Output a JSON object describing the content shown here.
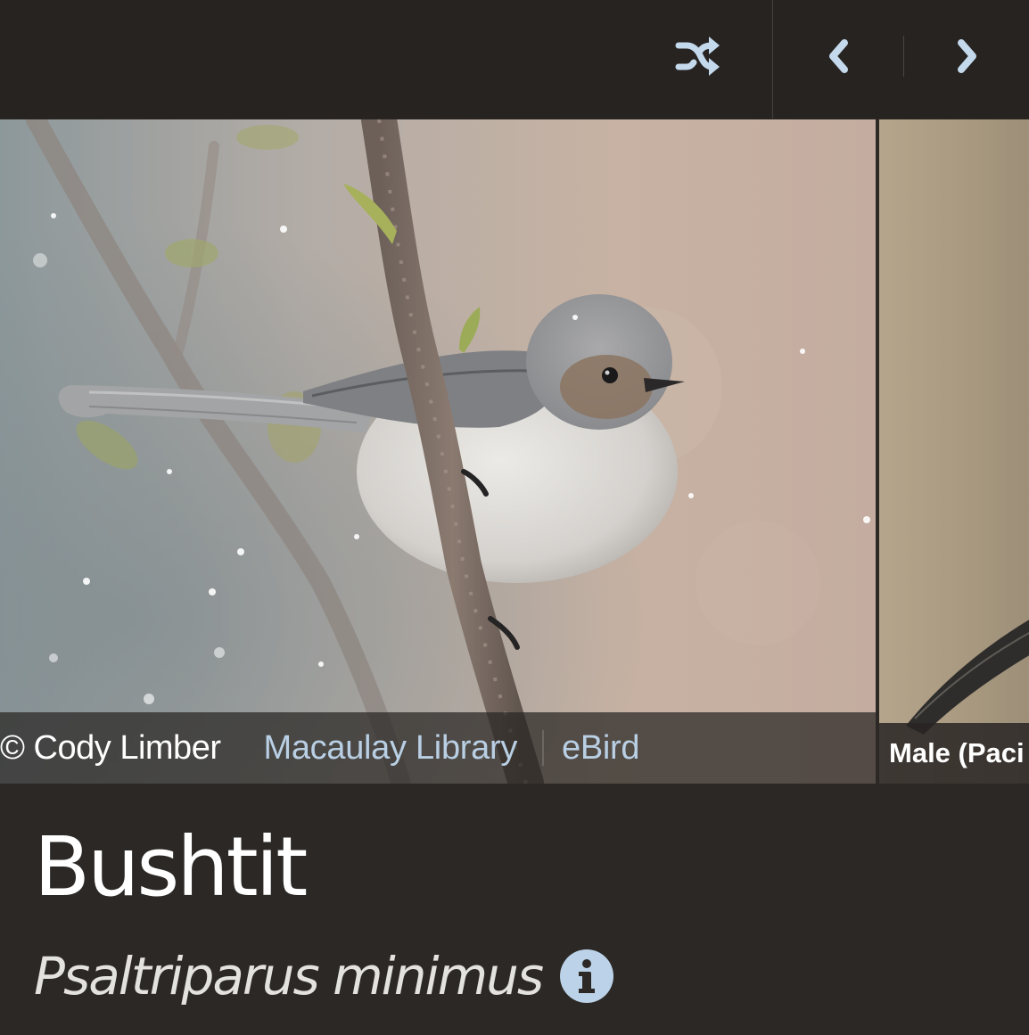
{
  "toolbar": {
    "shuffle_icon": "shuffle-icon",
    "prev_icon": "chevron-left-icon",
    "next_icon": "chevron-right-icon",
    "icon_color": "#c4d9ec"
  },
  "gallery": {
    "current": {
      "credit_author": "© Cody Limber",
      "credit_source_1": "Macaulay Library",
      "credit_source_2": "eBird"
    },
    "next": {
      "caption": "Male (Paci"
    }
  },
  "species": {
    "common_name": "Bushtit",
    "scientific_name": "Psaltriparus minimus",
    "info_icon": "info-icon"
  },
  "colors": {
    "background": "#2b2825",
    "toolbar": "#262321",
    "link": "#b9cfe4",
    "info_badge": "#bcd2e8"
  }
}
